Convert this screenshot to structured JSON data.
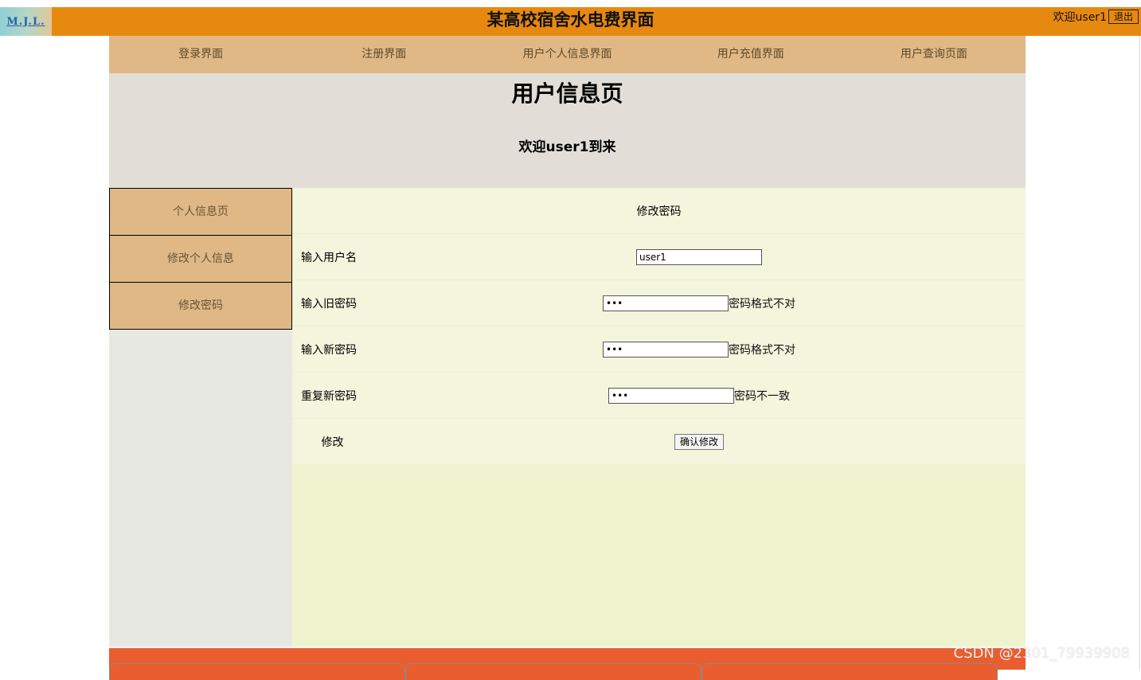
{
  "header": {
    "logo_text": "M.J.L.",
    "title": "某高校宿舍水电费界面",
    "welcome": "欢迎user1",
    "logout_label": "退出"
  },
  "nav": {
    "items": [
      {
        "label": "登录界面"
      },
      {
        "label": "注册界面"
      },
      {
        "label": "用户个人信息界面"
      },
      {
        "label": "用户充值界面"
      },
      {
        "label": "用户查询页面"
      }
    ]
  },
  "banner": {
    "title": "用户信息页",
    "subtitle": "欢迎user1到来"
  },
  "sidebar": {
    "items": [
      {
        "label": "个人信息页"
      },
      {
        "label": "修改个人信息"
      },
      {
        "label": "修改密码"
      }
    ]
  },
  "form": {
    "heading": "修改密码",
    "username_label": "输入用户名",
    "username_value": "user1",
    "old_pw_label": "输入旧密码",
    "old_pw_value": "•••",
    "old_pw_error": "密码格式不对",
    "new_pw_label": "输入新密码",
    "new_pw_value": "•••",
    "new_pw_error": "密码格式不对",
    "repeat_pw_label": "重复新密码",
    "repeat_pw_value": "•••",
    "repeat_pw_error": "密码不一致",
    "submit_row_label": "修改",
    "submit_label": "确认修改"
  },
  "watermark": "CSDN @2301_79939908",
  "colors": {
    "header_orange": "#e8890f",
    "nav_tan": "#dfb886",
    "banner_gray": "#e2ded7",
    "content_green": "#eff4cf",
    "footer_red": "#ea5d2f"
  }
}
